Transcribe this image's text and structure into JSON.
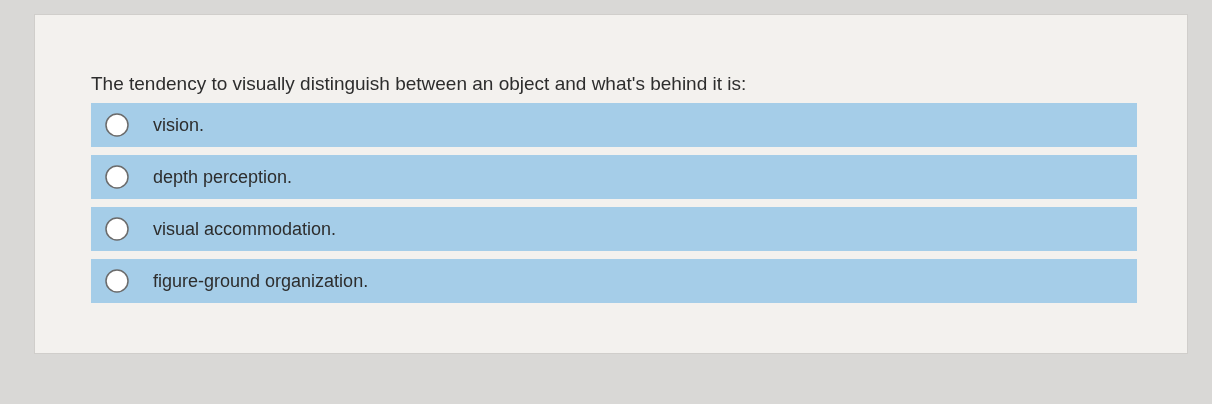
{
  "question": {
    "text": "The tendency to visually distinguish between an object and what's behind it is:",
    "options": [
      {
        "label": "vision.",
        "selected": false
      },
      {
        "label": "depth perception.",
        "selected": false
      },
      {
        "label": "visual accommodation.",
        "selected": false
      },
      {
        "label": "figure-ground organization.",
        "selected": false
      }
    ]
  }
}
